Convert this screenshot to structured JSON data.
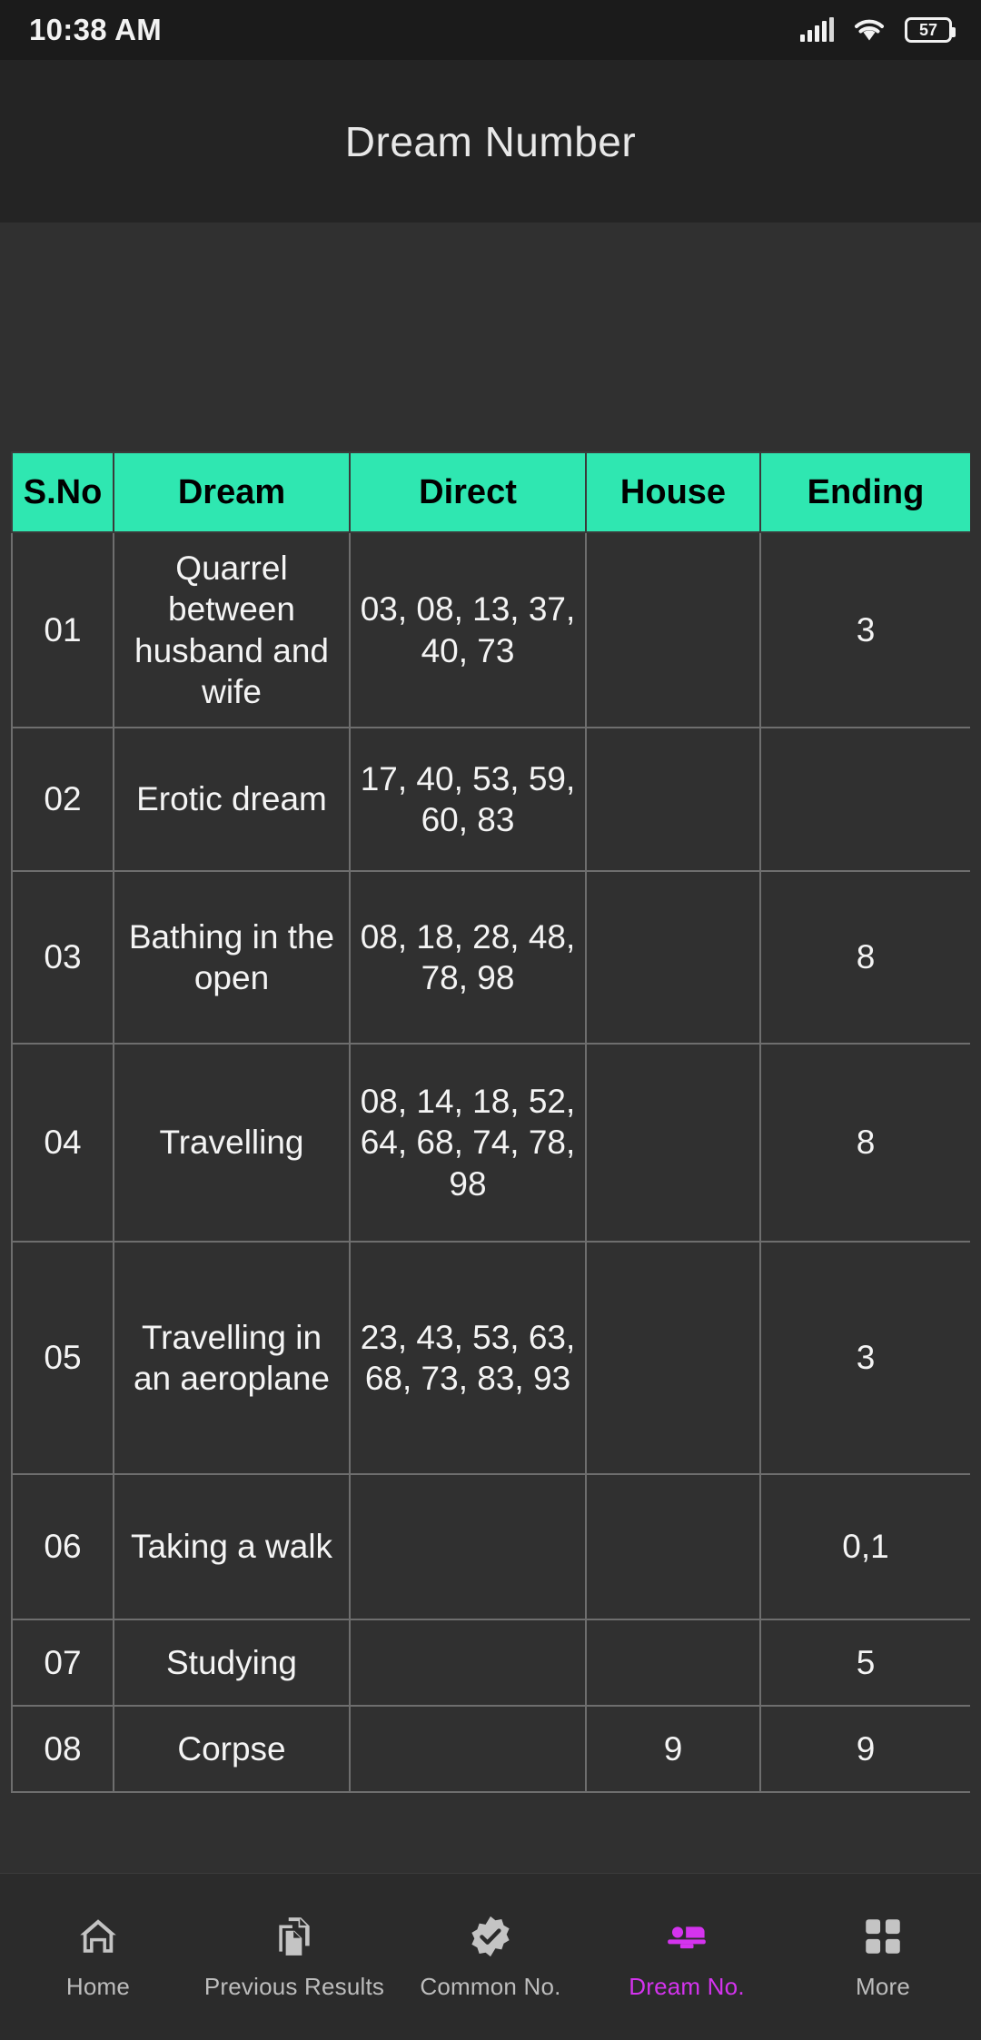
{
  "status_bar": {
    "time": "10:38 AM",
    "battery_percent": "57",
    "icons": [
      "signal-icon",
      "wifi-icon",
      "battery-icon"
    ]
  },
  "app_bar": {
    "title": "Dream Number"
  },
  "table": {
    "columns": [
      "S.No",
      "Dream",
      "Direct",
      "House",
      "Ending"
    ],
    "rows": [
      {
        "sno": "01",
        "dream": "Quarrel between husband and wife",
        "direct": "03, 08, 13, 37, 40, 73",
        "house": "",
        "ending": "3"
      },
      {
        "sno": "02",
        "dream": "Erotic dream",
        "direct": "17, 40, 53, 59, 60, 83",
        "house": "",
        "ending": ""
      },
      {
        "sno": "03",
        "dream": "Bathing in the open",
        "direct": "08, 18, 28, 48, 78, 98",
        "house": "",
        "ending": "8"
      },
      {
        "sno": "04",
        "dream": "Travelling",
        "direct": "08, 14, 18, 52, 64, 68, 74, 78, 98",
        "house": "",
        "ending": "8"
      },
      {
        "sno": "05",
        "dream": "Travelling in an aeroplane",
        "direct": "23, 43, 53, 63, 68, 73, 83, 93",
        "house": "",
        "ending": "3"
      },
      {
        "sno": "06",
        "dream": "Taking a walk",
        "direct": "",
        "house": "",
        "ending": "0,1"
      },
      {
        "sno": "07",
        "dream": "Studying",
        "direct": "",
        "house": "",
        "ending": "5"
      },
      {
        "sno": "08",
        "dream": "Corpse",
        "direct": "",
        "house": "9",
        "ending": "9"
      }
    ]
  },
  "bottom_nav": {
    "items": [
      {
        "label": "Home",
        "icon": "home-icon",
        "active": false
      },
      {
        "label": "Previous Results",
        "icon": "documents-icon",
        "active": false
      },
      {
        "label": "Common No.",
        "icon": "verified-badge-icon",
        "active": false
      },
      {
        "label": "Dream No.",
        "icon": "bed-icon",
        "active": true
      },
      {
        "label": "More",
        "icon": "grid-icon",
        "active": false
      }
    ]
  },
  "colors": {
    "header_accent": "#2fe7b1",
    "active_nav": "#d433ee",
    "background": "#303030",
    "app_bar": "#242424",
    "status_bar": "#1b1b1b"
  }
}
